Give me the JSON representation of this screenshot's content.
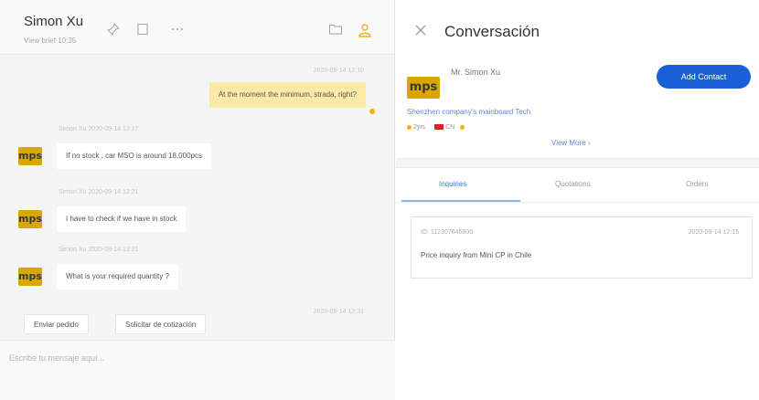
{
  "chat": {
    "contact_name": "Simon Xu",
    "contact_sub": "View brief 10:35",
    "messages": [
      {
        "direction": "out",
        "time": "2020-09-14 12:10",
        "text": "At the moment the minimum, strada, right?"
      },
      {
        "direction": "in",
        "sender_time": "Simon Xu  2020-09-14 12:17",
        "text": "If no stock , car MSO is around 18,000pcs"
      },
      {
        "direction": "in",
        "sender_time": "Simon Xu  2020-09-14 12:21",
        "text": "I have to check if we have in stock"
      },
      {
        "direction": "in",
        "sender_time": "Simon Xu  2020-09-14 12:21",
        "text": "What is your required quantity ?"
      }
    ],
    "last_time": "2020-09-14 12:31",
    "quick_replies": [
      "Enviar pedido",
      "Solicitar de cotización"
    ],
    "input_placeholder": "Escribe tu mensaje aquí..."
  },
  "panel": {
    "title": "Conversación",
    "contact_name": "Mr. Simon Xu",
    "add_contact_label": "Add Contact",
    "company": "Shenzhen company's mainboard Tech",
    "tags": [
      "2yrs",
      "CN"
    ],
    "view_more": "View More",
    "tabs": [
      "Inquiries",
      "Quotations",
      "Orders"
    ],
    "active_tab": 0,
    "inquiry": {
      "id": "ID: 112307645600",
      "date": "2020-09-14 12:15",
      "text": "Price inquiry from Mini CP in Chile"
    }
  },
  "avatar_text": "mps",
  "colors": {
    "accent": "#1a5fd8",
    "bubble_out": "#fbeaa7",
    "avatar": "#d9a800"
  },
  "icons": {
    "pin": "pin-icon",
    "note": "note-icon",
    "more": "more-icon",
    "folder": "folder-icon",
    "profile": "profile-icon",
    "close": "close-icon"
  }
}
